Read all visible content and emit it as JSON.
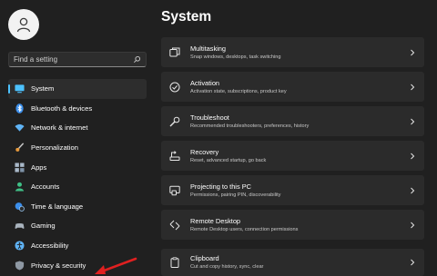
{
  "sidebar": {
    "search_placeholder": "Find a setting",
    "items": [
      {
        "label": "System",
        "icon": "monitor-icon",
        "active": true
      },
      {
        "label": "Bluetooth & devices",
        "icon": "bluetooth-icon"
      },
      {
        "label": "Network & internet",
        "icon": "wifi-icon"
      },
      {
        "label": "Personalization",
        "icon": "paintbrush-icon"
      },
      {
        "label": "Apps",
        "icon": "apps-icon"
      },
      {
        "label": "Accounts",
        "icon": "person-icon"
      },
      {
        "label": "Time & language",
        "icon": "globe-clock-icon"
      },
      {
        "label": "Gaming",
        "icon": "gamepad-icon"
      },
      {
        "label": "Accessibility",
        "icon": "accessibility-icon"
      },
      {
        "label": "Privacy & security",
        "icon": "shield-icon"
      }
    ]
  },
  "main": {
    "title": "System",
    "cards": [
      {
        "title": "Multitasking",
        "subtitle": "Snap windows, desktops, task switching",
        "icon": "multitasking-icon"
      },
      {
        "title": "Activation",
        "subtitle": "Activation state, subscriptions, product key",
        "icon": "activation-check-icon"
      },
      {
        "title": "Troubleshoot",
        "subtitle": "Recommended troubleshooters, preferences, history",
        "icon": "wrench-icon"
      },
      {
        "title": "Recovery",
        "subtitle": "Reset, advanced startup, go back",
        "icon": "recovery-icon"
      },
      {
        "title": "Projecting to this PC",
        "subtitle": "Permissions, pairing PIN, discoverability",
        "icon": "projecting-icon"
      },
      {
        "title": "Remote Desktop",
        "subtitle": "Remote Desktop users, connection permissions",
        "icon": "remote-desktop-icon"
      },
      {
        "title": "Clipboard",
        "subtitle": "Cut and copy history, sync, clear",
        "icon": "clipboard-icon"
      }
    ]
  },
  "colors": {
    "background": "#202020",
    "card": "#2b2b2b",
    "accent": "#4cc2ff",
    "annotation_arrow": "#e02020"
  }
}
